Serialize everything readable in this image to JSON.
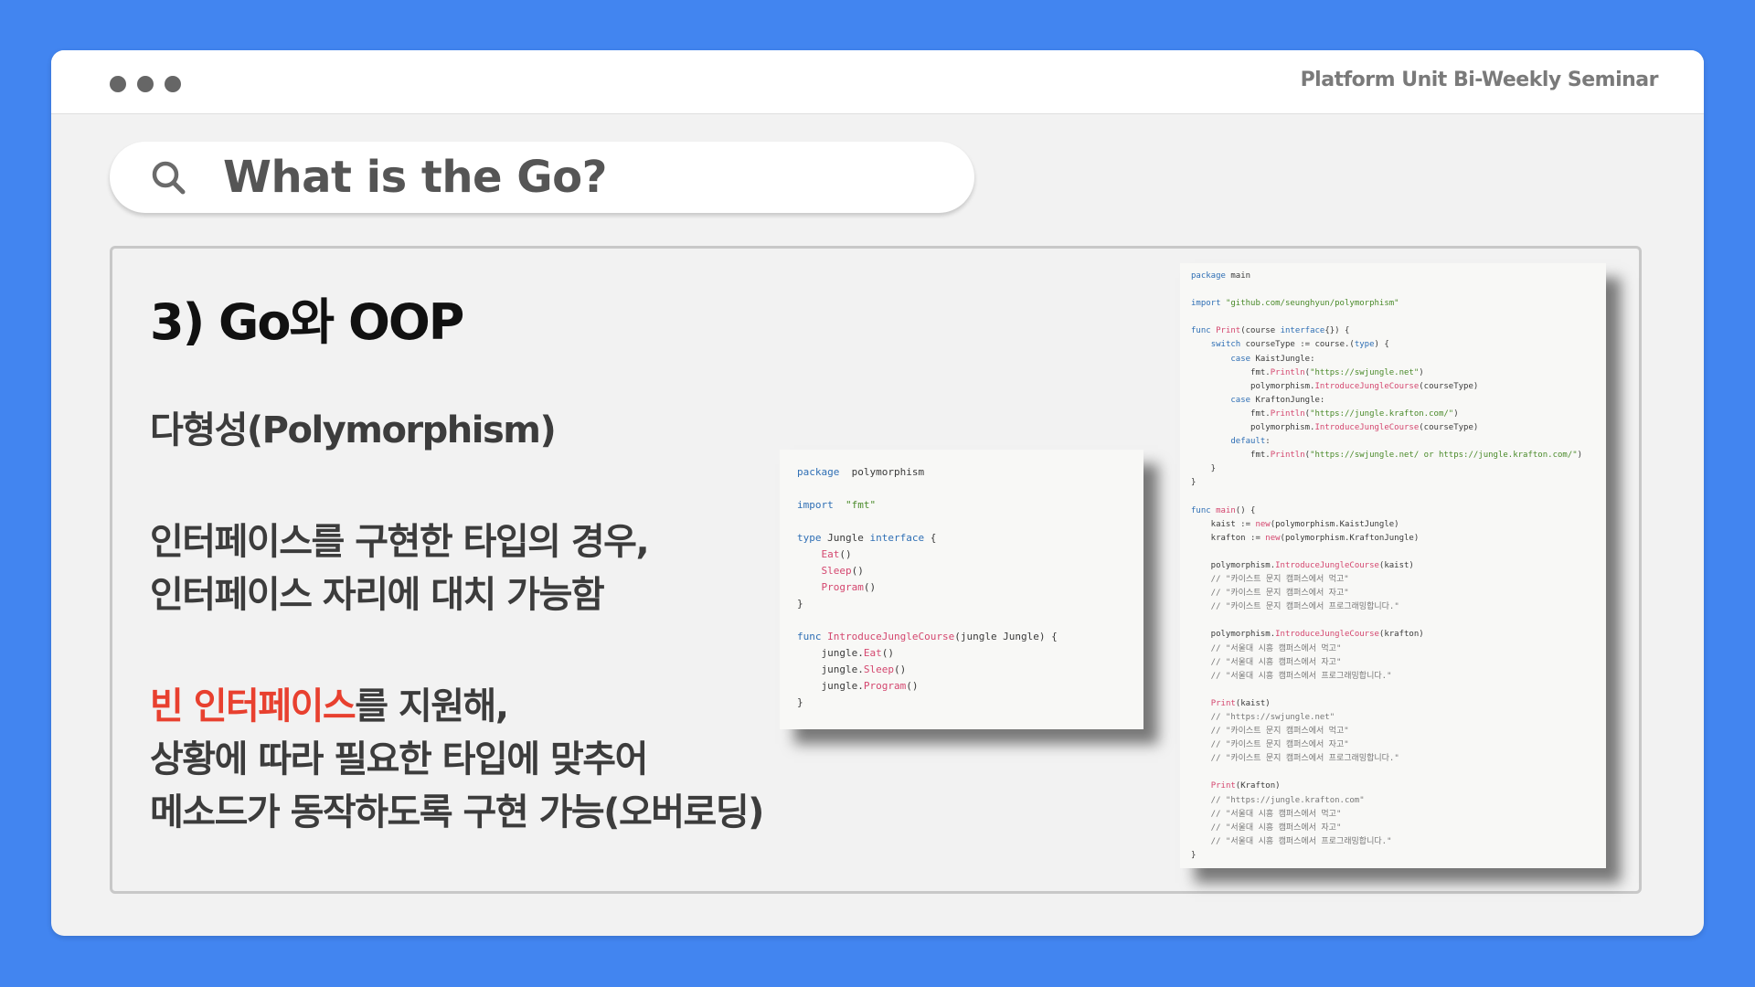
{
  "window": {
    "title": "Platform Unit Bi-Weekly Seminar",
    "dots": [
      "window-dot",
      "window-dot",
      "window-dot"
    ]
  },
  "search": {
    "icon": "search-icon",
    "text": "What is the Go?"
  },
  "section": {
    "title": "3) Go와 OOP",
    "subtitle": "다형성(Polymorphism)",
    "para1_line1": "인터페이스를 구현한 타입의 경우,",
    "para1_line2": "인터페이스 자리에 대치 가능함",
    "para2_highlight": "빈 인터페이스",
    "para2_line1_rest": "를 지원해,",
    "para2_line2": "상황에 따라 필요한 타입에 맞추어",
    "para2_line3": "메소드가 동작하도록 구현 가능(오버로딩)"
  },
  "colors": {
    "background": "#4285f0",
    "highlight": "#e8402f",
    "keyword": "#2f6fb5",
    "function": "#d4476f",
    "string": "#4a8a2a"
  },
  "code_small": [
    [
      [
        "kw",
        "package"
      ],
      [
        "",
        "  polymorphism"
      ]
    ],
    [],
    [
      [
        "kw",
        "import"
      ],
      [
        "",
        "  "
      ],
      [
        "str",
        "\"fmt\""
      ]
    ],
    [],
    [
      [
        "kw",
        "type"
      ],
      [
        "",
        " Jungle "
      ],
      [
        "kw",
        "interface"
      ],
      [
        "",
        " {"
      ]
    ],
    [
      [
        "",
        "    "
      ],
      [
        "fn",
        "Eat"
      ],
      [
        "",
        "()"
      ]
    ],
    [
      [
        "",
        "    "
      ],
      [
        "fn",
        "Sleep"
      ],
      [
        "",
        "()"
      ]
    ],
    [
      [
        "",
        "    "
      ],
      [
        "fn",
        "Program"
      ],
      [
        "",
        "()"
      ]
    ],
    [
      [
        "",
        "}"
      ]
    ],
    [],
    [
      [
        "kw",
        "func"
      ],
      [
        "",
        " "
      ],
      [
        "fn",
        "IntroduceJungleCourse"
      ],
      [
        "",
        "(jungle Jungle) {"
      ]
    ],
    [
      [
        "",
        "    jungle."
      ],
      [
        "fn",
        "Eat"
      ],
      [
        "",
        "()"
      ]
    ],
    [
      [
        "",
        "    jungle."
      ],
      [
        "fn",
        "Sleep"
      ],
      [
        "",
        "()"
      ]
    ],
    [
      [
        "",
        "    jungle."
      ],
      [
        "fn",
        "Program"
      ],
      [
        "",
        "()"
      ]
    ],
    [
      [
        "",
        "}"
      ]
    ]
  ],
  "code_large": [
    [
      [
        "kw",
        "package"
      ],
      [
        "",
        " main"
      ]
    ],
    [],
    [
      [
        "kw",
        "import"
      ],
      [
        "",
        " "
      ],
      [
        "str",
        "\"github.com/seunghyun/polymorphism\""
      ]
    ],
    [],
    [
      [
        "kw",
        "func"
      ],
      [
        "",
        " "
      ],
      [
        "fn",
        "Print"
      ],
      [
        "",
        "(course "
      ],
      [
        "kw",
        "interface"
      ],
      [
        "",
        "{}) {"
      ]
    ],
    [
      [
        "",
        "    "
      ],
      [
        "kw",
        "switch"
      ],
      [
        "",
        " courseType := course.("
      ],
      [
        "kw",
        "type"
      ],
      [
        "",
        ") {"
      ]
    ],
    [
      [
        "",
        "        "
      ],
      [
        "kw",
        "case"
      ],
      [
        "",
        " KaistJungle:"
      ]
    ],
    [
      [
        "",
        "            fmt."
      ],
      [
        "fn",
        "Println"
      ],
      [
        "",
        "("
      ],
      [
        "str",
        "\"https://swjungle.net\""
      ],
      [
        "",
        ")"
      ]
    ],
    [
      [
        "",
        "            polymorphism."
      ],
      [
        "fn",
        "IntroduceJungleCourse"
      ],
      [
        "",
        "(courseType)"
      ]
    ],
    [
      [
        "",
        "        "
      ],
      [
        "kw",
        "case"
      ],
      [
        "",
        " KraftonJungle:"
      ]
    ],
    [
      [
        "",
        "            fmt."
      ],
      [
        "fn",
        "Println"
      ],
      [
        "",
        "("
      ],
      [
        "str",
        "\"https://jungle.krafton.com/\""
      ],
      [
        "",
        ")"
      ]
    ],
    [
      [
        "",
        "            polymorphism."
      ],
      [
        "fn",
        "IntroduceJungleCourse"
      ],
      [
        "",
        "(courseType)"
      ]
    ],
    [
      [
        "",
        "        "
      ],
      [
        "kw",
        "default"
      ],
      [
        "",
        ":"
      ]
    ],
    [
      [
        "",
        "            fmt."
      ],
      [
        "fn",
        "Println"
      ],
      [
        "",
        "("
      ],
      [
        "str",
        "\"https://swjungle.net/ or https://jungle.krafton.com/\""
      ],
      [
        "",
        ")"
      ]
    ],
    [
      [
        "",
        "    }"
      ]
    ],
    [
      [
        "",
        "}"
      ]
    ],
    [],
    [
      [
        "kw",
        "func"
      ],
      [
        "",
        " "
      ],
      [
        "fn",
        "main"
      ],
      [
        "",
        "() {"
      ]
    ],
    [
      [
        "",
        "    kaist := "
      ],
      [
        "fn",
        "new"
      ],
      [
        "",
        "(polymorphism.KaistJungle)"
      ]
    ],
    [
      [
        "",
        "    krafton := "
      ],
      [
        "fn",
        "new"
      ],
      [
        "",
        "(polymorphism.KraftonJungle)"
      ]
    ],
    [],
    [
      [
        "",
        "    polymorphism."
      ],
      [
        "fn",
        "IntroduceJungleCourse"
      ],
      [
        "",
        "(kaist)"
      ]
    ],
    [
      [
        "cm",
        "    // \"카이스트 문지 캠퍼스에서 먹고\""
      ]
    ],
    [
      [
        "cm",
        "    // \"카이스트 문지 캠퍼스에서 자고\""
      ]
    ],
    [
      [
        "cm",
        "    // \"카이스트 문지 캠퍼스에서 프로그래밍합니다.\""
      ]
    ],
    [],
    [
      [
        "",
        "    polymorphism."
      ],
      [
        "fn",
        "IntroduceJungleCourse"
      ],
      [
        "",
        "(krafton)"
      ]
    ],
    [
      [
        "cm",
        "    // \"서울대 시흥 캠퍼스에서 먹고\""
      ]
    ],
    [
      [
        "cm",
        "    // \"서울대 시흥 캠퍼스에서 자고\""
      ]
    ],
    [
      [
        "cm",
        "    // \"서울대 시흥 캠퍼스에서 프로그래밍합니다.\""
      ]
    ],
    [],
    [
      [
        "",
        "    "
      ],
      [
        "fn",
        "Print"
      ],
      [
        "",
        "(kaist)"
      ]
    ],
    [
      [
        "cm",
        "    // \"https://swjungle.net\""
      ]
    ],
    [
      [
        "cm",
        "    // \"카이스트 문지 캠퍼스에서 먹고\""
      ]
    ],
    [
      [
        "cm",
        "    // \"카이스트 문지 캠퍼스에서 자고\""
      ]
    ],
    [
      [
        "cm",
        "    // \"카이스트 문지 캠퍼스에서 프로그래밍합니다.\""
      ]
    ],
    [],
    [
      [
        "",
        "    "
      ],
      [
        "fn",
        "Print"
      ],
      [
        "",
        "(Krafton)"
      ]
    ],
    [
      [
        "cm",
        "    // \"https://jungle.krafton.com\""
      ]
    ],
    [
      [
        "cm",
        "    // \"서울대 시흥 캠퍼스에서 먹고\""
      ]
    ],
    [
      [
        "cm",
        "    // \"서울대 시흥 캠퍼스에서 자고\""
      ]
    ],
    [
      [
        "cm",
        "    // \"서울대 시흥 캠퍼스에서 프로그래밍합니다.\""
      ]
    ],
    [
      [
        "",
        "}"
      ]
    ]
  ]
}
